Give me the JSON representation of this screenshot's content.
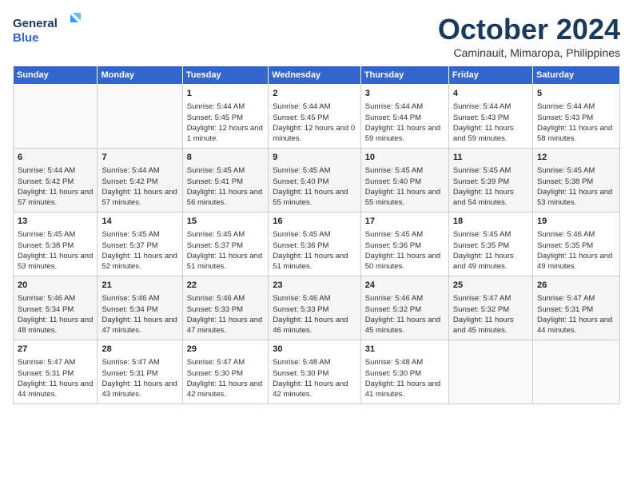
{
  "logo": {
    "line1": "General",
    "line2": "Blue"
  },
  "title": "October 2024",
  "subtitle": "Caminauit, Mimaropa, Philippines",
  "days_of_week": [
    "Sunday",
    "Monday",
    "Tuesday",
    "Wednesday",
    "Thursday",
    "Friday",
    "Saturday"
  ],
  "weeks": [
    [
      {
        "day": "",
        "sunrise": "",
        "sunset": "",
        "daylight": ""
      },
      {
        "day": "",
        "sunrise": "",
        "sunset": "",
        "daylight": ""
      },
      {
        "day": "1",
        "sunrise": "Sunrise: 5:44 AM",
        "sunset": "Sunset: 5:45 PM",
        "daylight": "Daylight: 12 hours and 1 minute."
      },
      {
        "day": "2",
        "sunrise": "Sunrise: 5:44 AM",
        "sunset": "Sunset: 5:45 PM",
        "daylight": "Daylight: 12 hours and 0 minutes."
      },
      {
        "day": "3",
        "sunrise": "Sunrise: 5:44 AM",
        "sunset": "Sunset: 5:44 PM",
        "daylight": "Daylight: 11 hours and 59 minutes."
      },
      {
        "day": "4",
        "sunrise": "Sunrise: 5:44 AM",
        "sunset": "Sunset: 5:43 PM",
        "daylight": "Daylight: 11 hours and 59 minutes."
      },
      {
        "day": "5",
        "sunrise": "Sunrise: 5:44 AM",
        "sunset": "Sunset: 5:43 PM",
        "daylight": "Daylight: 11 hours and 58 minutes."
      }
    ],
    [
      {
        "day": "6",
        "sunrise": "Sunrise: 5:44 AM",
        "sunset": "Sunset: 5:42 PM",
        "daylight": "Daylight: 11 hours and 57 minutes."
      },
      {
        "day": "7",
        "sunrise": "Sunrise: 5:44 AM",
        "sunset": "Sunset: 5:42 PM",
        "daylight": "Daylight: 11 hours and 57 minutes."
      },
      {
        "day": "8",
        "sunrise": "Sunrise: 5:45 AM",
        "sunset": "Sunset: 5:41 PM",
        "daylight": "Daylight: 11 hours and 56 minutes."
      },
      {
        "day": "9",
        "sunrise": "Sunrise: 5:45 AM",
        "sunset": "Sunset: 5:40 PM",
        "daylight": "Daylight: 11 hours and 55 minutes."
      },
      {
        "day": "10",
        "sunrise": "Sunrise: 5:45 AM",
        "sunset": "Sunset: 5:40 PM",
        "daylight": "Daylight: 11 hours and 55 minutes."
      },
      {
        "day": "11",
        "sunrise": "Sunrise: 5:45 AM",
        "sunset": "Sunset: 5:39 PM",
        "daylight": "Daylight: 11 hours and 54 minutes."
      },
      {
        "day": "12",
        "sunrise": "Sunrise: 5:45 AM",
        "sunset": "Sunset: 5:38 PM",
        "daylight": "Daylight: 11 hours and 53 minutes."
      }
    ],
    [
      {
        "day": "13",
        "sunrise": "Sunrise: 5:45 AM",
        "sunset": "Sunset: 5:38 PM",
        "daylight": "Daylight: 11 hours and 53 minutes."
      },
      {
        "day": "14",
        "sunrise": "Sunrise: 5:45 AM",
        "sunset": "Sunset: 5:37 PM",
        "daylight": "Daylight: 11 hours and 52 minutes."
      },
      {
        "day": "15",
        "sunrise": "Sunrise: 5:45 AM",
        "sunset": "Sunset: 5:37 PM",
        "daylight": "Daylight: 11 hours and 51 minutes."
      },
      {
        "day": "16",
        "sunrise": "Sunrise: 5:45 AM",
        "sunset": "Sunset: 5:36 PM",
        "daylight": "Daylight: 11 hours and 51 minutes."
      },
      {
        "day": "17",
        "sunrise": "Sunrise: 5:45 AM",
        "sunset": "Sunset: 5:36 PM",
        "daylight": "Daylight: 11 hours and 50 minutes."
      },
      {
        "day": "18",
        "sunrise": "Sunrise: 5:45 AM",
        "sunset": "Sunset: 5:35 PM",
        "daylight": "Daylight: 11 hours and 49 minutes."
      },
      {
        "day": "19",
        "sunrise": "Sunrise: 5:46 AM",
        "sunset": "Sunset: 5:35 PM",
        "daylight": "Daylight: 11 hours and 49 minutes."
      }
    ],
    [
      {
        "day": "20",
        "sunrise": "Sunrise: 5:46 AM",
        "sunset": "Sunset: 5:34 PM",
        "daylight": "Daylight: 11 hours and 48 minutes."
      },
      {
        "day": "21",
        "sunrise": "Sunrise: 5:46 AM",
        "sunset": "Sunset: 5:34 PM",
        "daylight": "Daylight: 11 hours and 47 minutes."
      },
      {
        "day": "22",
        "sunrise": "Sunrise: 5:46 AM",
        "sunset": "Sunset: 5:33 PM",
        "daylight": "Daylight: 11 hours and 47 minutes."
      },
      {
        "day": "23",
        "sunrise": "Sunrise: 5:46 AM",
        "sunset": "Sunset: 5:33 PM",
        "daylight": "Daylight: 11 hours and 46 minutes."
      },
      {
        "day": "24",
        "sunrise": "Sunrise: 5:46 AM",
        "sunset": "Sunset: 5:32 PM",
        "daylight": "Daylight: 11 hours and 45 minutes."
      },
      {
        "day": "25",
        "sunrise": "Sunrise: 5:47 AM",
        "sunset": "Sunset: 5:32 PM",
        "daylight": "Daylight: 11 hours and 45 minutes."
      },
      {
        "day": "26",
        "sunrise": "Sunrise: 5:47 AM",
        "sunset": "Sunset: 5:31 PM",
        "daylight": "Daylight: 11 hours and 44 minutes."
      }
    ],
    [
      {
        "day": "27",
        "sunrise": "Sunrise: 5:47 AM",
        "sunset": "Sunset: 5:31 PM",
        "daylight": "Daylight: 11 hours and 44 minutes."
      },
      {
        "day": "28",
        "sunrise": "Sunrise: 5:47 AM",
        "sunset": "Sunset: 5:31 PM",
        "daylight": "Daylight: 11 hours and 43 minutes."
      },
      {
        "day": "29",
        "sunrise": "Sunrise: 5:47 AM",
        "sunset": "Sunset: 5:30 PM",
        "daylight": "Daylight: 11 hours and 42 minutes."
      },
      {
        "day": "30",
        "sunrise": "Sunrise: 5:48 AM",
        "sunset": "Sunset: 5:30 PM",
        "daylight": "Daylight: 11 hours and 42 minutes."
      },
      {
        "day": "31",
        "sunrise": "Sunrise: 5:48 AM",
        "sunset": "Sunset: 5:30 PM",
        "daylight": "Daylight: 11 hours and 41 minutes."
      },
      {
        "day": "",
        "sunrise": "",
        "sunset": "",
        "daylight": ""
      },
      {
        "day": "",
        "sunrise": "",
        "sunset": "",
        "daylight": ""
      }
    ]
  ]
}
